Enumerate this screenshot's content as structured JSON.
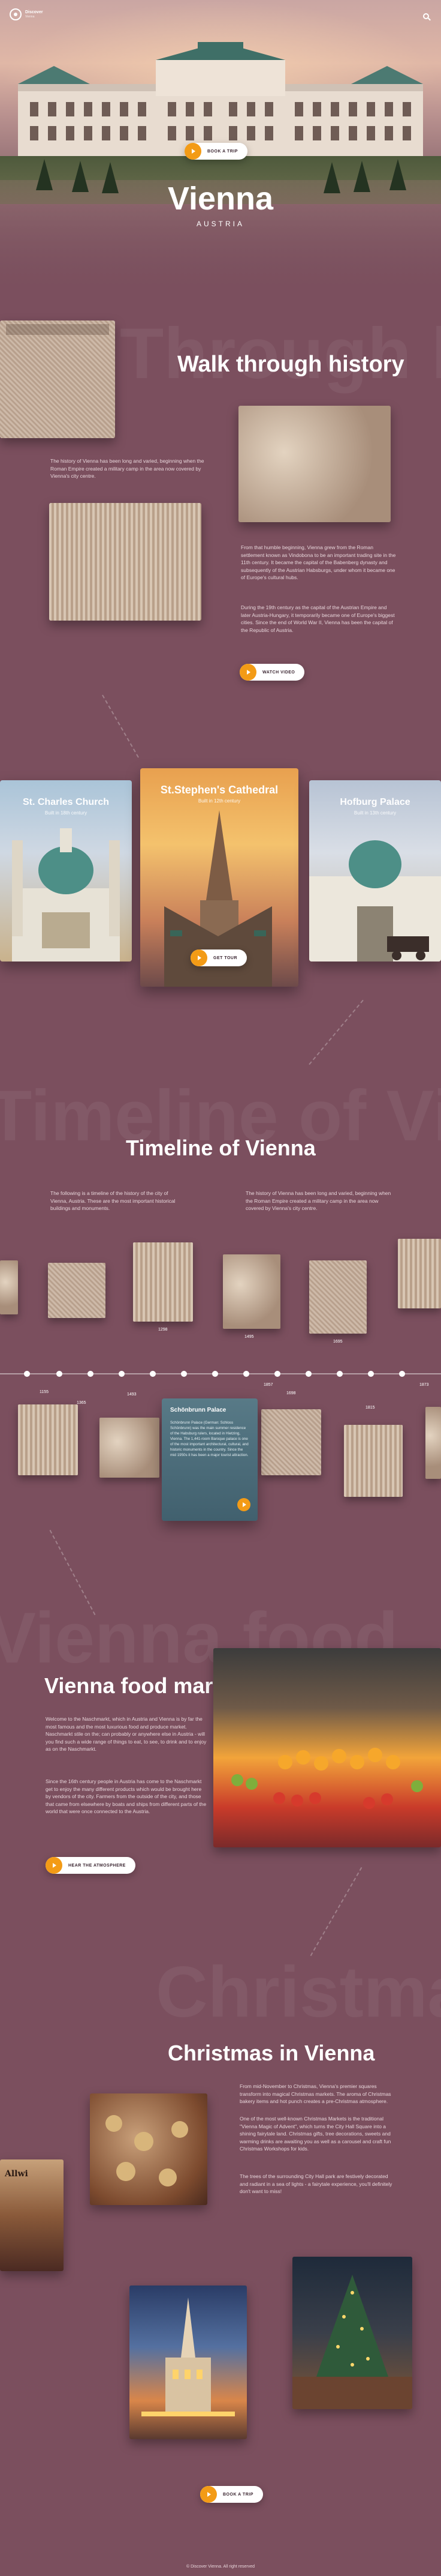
{
  "header": {
    "logo_title": "Discover",
    "logo_sub": "Vienna",
    "book_label": "BOOK A TRIP"
  },
  "hero": {
    "title": "Vienna",
    "subtitle": "AUSTRIA"
  },
  "history": {
    "bg_word": "Through history",
    "title": "Walk through history",
    "p1": "The history of Vienna has been long and varied, beginning when the Roman Empire created a military camp in the area now covered by Vienna's city centre.",
    "p2": "From that humble beginning, Vienna grew from the Roman settlement known as Vindobona to be an important trading site in the 11th century. It became the capital of the Babenberg dynasty and subsequently of the Austrian Habsburgs, under whom it became one of Europe's cultural hubs.",
    "p3": "During the 19th century as the capital of the Austrian Empire and later Austria-Hungary, it temporarily became one of Europe's biggest cities. Since the end of World War II, Vienna has been the capital of the Republic of Austria.",
    "watch_label": "WATCH VIDEO"
  },
  "landmarks": {
    "cards": [
      {
        "title": "St. Charles Church",
        "sub": "Built in 18th century"
      },
      {
        "title": "St.Stephen's Cathedral",
        "sub": "Built in 12th century"
      },
      {
        "title": "Hofburg Palace",
        "sub": "Built in 13th century"
      }
    ],
    "tour_label": "GET TOUR"
  },
  "timeline": {
    "bg_word": "Timeline of Vienna",
    "title": "Timeline of Vienna",
    "p1": "The following is a timeline of the history of the city of Vienna, Austria. These are the most important historical buildings and monuments.",
    "p2": "The history of Vienna has been long and varied, beginning when the Roman Empire created a military camp in the area now covered by Vienna's city centre.",
    "years": [
      "1155",
      "1365",
      "1493",
      "1683",
      "1698",
      "1815",
      "1857",
      "1873"
    ],
    "captions": [
      "1298",
      "1495",
      "1695"
    ],
    "featured": {
      "title": "Schönbrunn Palace",
      "text": "Schönbrunn Palace (German: Schloss Schönbrunn) was the main summer residence of the Habsburg rulers, located in Hietzing, Vienna. The 1,441-room Baroque palace is one of the most important architectural, cultural, and historic monuments in the country. Since the mid 1950s it has been a major tourist attraction."
    }
  },
  "food": {
    "bg_word": "Vienna food",
    "title": "Vienna food market",
    "p1": "Welcome to the Naschmarkt, which in Austria and Vienna is by far the most famous and the most luxurious food and produce market. Naschmarkt stile on the; can probably or anywhere else in Austria - will you find such a wide range of things to eat, to see, to drink and to enjoy as on the Naschmarkt.",
    "p2": "Since the 16th century people in Austria has come to the Naschmarkt get to enjoy the many different products which would be brought here by vendors of the city. Farmers from the outside of the city, and those that came from elsewhere by boats and ships from different parts of the world that were once connected to the Austria.",
    "btn_label": "HEAR THE ATMOSPHERE"
  },
  "christmas": {
    "bg_word": "Christmas",
    "title": "Christmas in Vienna",
    "p1": "From mid-November to Christmas, Vienna's premier squares transform into magical Christmas markets. The aroma of Christmas bakery items and hot punch creates a pre-Christmas atmosphere.",
    "p2": "One of the most well-known Christmas Markets is the traditional \"Vienna Magic of Advent\", which turns the City Hall Square into a shining fairytale land. Christmas gifts, tree decorations, sweets and warming drinks are awaiting you as well as a carousel and craft fun Christmas Workshops for kids.",
    "p3": "The trees of the surrounding City Hall park are festively decorated and radiant in a sea of lights - a fairytale experience, you'll definitely don't want to miss!",
    "book_label": "BOOK A TRIP"
  },
  "footer": {
    "text": "© Discover Vienna. All right reserved"
  },
  "colors": {
    "accent": "#f39b16",
    "bg": "#7b4f5e"
  }
}
